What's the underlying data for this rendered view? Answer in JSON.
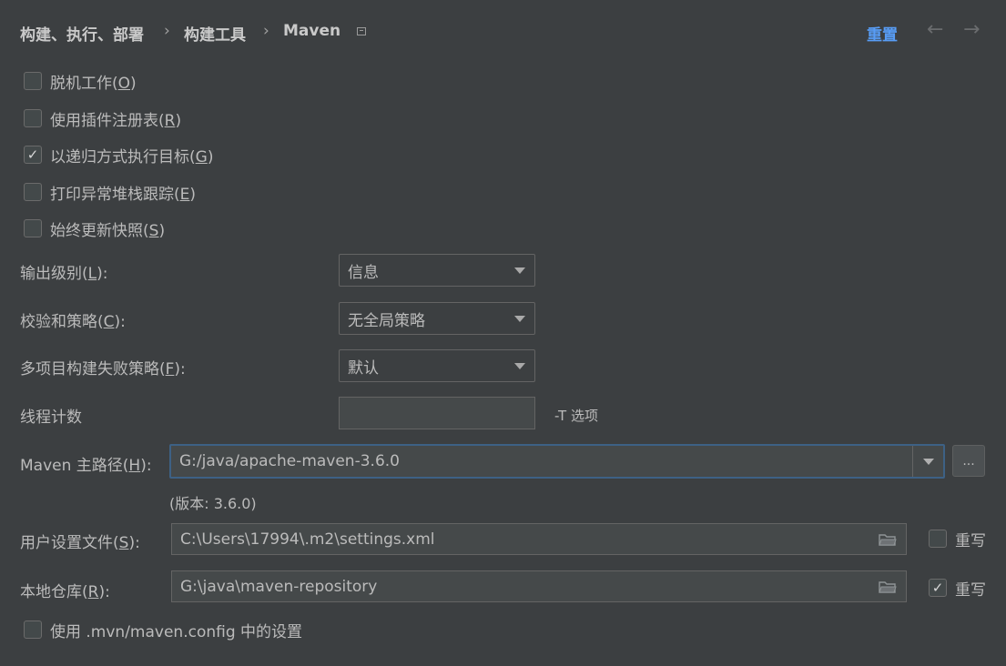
{
  "header": {
    "breadcrumb": [
      "构建、执行、部署",
      "构建工具",
      "Maven"
    ],
    "separator": "›",
    "reset_label": "重置",
    "back_arrow": "←",
    "forward_arrow": "→"
  },
  "checkboxes": [
    {
      "label": "脱机工作(",
      "mnemonic": "O",
      "suffix": ")",
      "checked": false
    },
    {
      "label": "使用插件注册表(",
      "mnemonic": "R",
      "suffix": ")",
      "checked": false
    },
    {
      "label": "以递归方式执行目标(",
      "mnemonic": "G",
      "suffix": ")",
      "checked": true
    },
    {
      "label": "打印异常堆栈跟踪(",
      "mnemonic": "E",
      "suffix": ")",
      "checked": false
    },
    {
      "label": "始终更新快照(",
      "mnemonic": "S",
      "suffix": ")",
      "checked": false
    }
  ],
  "output_level": {
    "label": "输出级别(",
    "mnemonic": "L",
    "suffix": "):",
    "value": "信息"
  },
  "checksum_policy": {
    "label": "校验和策略(",
    "mnemonic": "C",
    "suffix": "):",
    "value": "无全局策略"
  },
  "failure_policy": {
    "label": "多项目构建失败策略(",
    "mnemonic": "F",
    "suffix": "):",
    "value": "默认"
  },
  "threads": {
    "label": "线程计数",
    "value": "",
    "hint": "-T 选项"
  },
  "maven_home": {
    "label": "Maven 主路径(",
    "mnemonic": "H",
    "suffix": "):",
    "value": "G:/java/apache-maven-3.6.0",
    "browse_label": "...",
    "version": "(版本: 3.6.0)"
  },
  "user_settings": {
    "label": "用户设置文件(",
    "mnemonic": "S",
    "suffix": "):",
    "value": "C:\\Users\\17994\\.m2\\settings.xml",
    "override_label": "重写",
    "override_checked": false
  },
  "local_repo": {
    "label": "本地仓库(",
    "mnemonic": "R",
    "suffix": "):",
    "value": "G:\\java\\maven-repository",
    "override_label": "重写",
    "override_checked": true
  },
  "mvn_config": {
    "label": "使用 .mvn/maven.config 中的设置",
    "checked": false
  },
  "colors": {
    "background": "#3c3f41",
    "accent": "#589df6",
    "focus": "#3d6185"
  },
  "icons": {
    "check": "✓",
    "window": "window-icon",
    "folder": "folder-icon"
  }
}
